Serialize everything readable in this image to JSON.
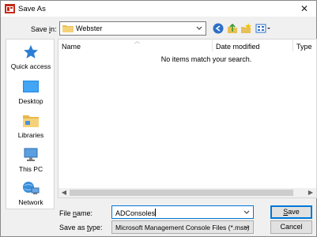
{
  "window": {
    "title": "Save As",
    "close_glyph": "✕"
  },
  "save_in": {
    "label_pre": "Save ",
    "label_u": "i",
    "label_post": "n:",
    "folder": "Webster"
  },
  "places": [
    {
      "label": "Quick access",
      "icon": "quick-access-star-icon"
    },
    {
      "label": "Desktop",
      "icon": "desktop-icon"
    },
    {
      "label": "Libraries",
      "icon": "libraries-icon"
    },
    {
      "label": "This PC",
      "icon": "this-pc-icon"
    },
    {
      "label": "Network",
      "icon": "network-icon"
    }
  ],
  "file_list": {
    "columns": [
      "Name",
      "Date modified",
      "Type"
    ],
    "empty_message": "No items match your search."
  },
  "file_name": {
    "label_pre": "File ",
    "label_u": "n",
    "label_post": "ame:",
    "value": "ADConsoles"
  },
  "file_type": {
    "label_pre": "Save as ",
    "label_u": "t",
    "label_post": "ype:",
    "value": "Microsoft Management Console Files (*.msc)"
  },
  "buttons": {
    "save_u": "S",
    "save_rest": "ave",
    "cancel": "Cancel"
  },
  "colors": {
    "accent": "#0078d7",
    "folder": "#e8c058",
    "quick_access_star": "#2a7fd4"
  }
}
